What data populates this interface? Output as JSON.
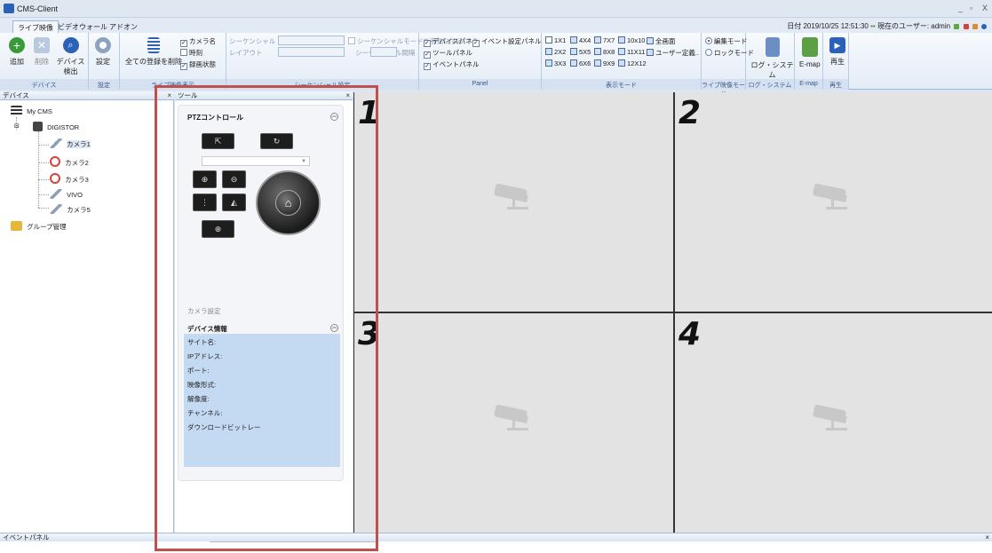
{
  "window": {
    "title": "CMS-Client",
    "controls": [
      "_",
      "▫",
      "X"
    ]
  },
  "ribbon_tabs": [
    "ライブ映像",
    "ビデオウォール",
    "アドオン"
  ],
  "date_label": "日付 2019/10/25 12:51:30 ",
  "user_label": "現在のユーザー: admin",
  "groups": {
    "device": {
      "label": "デバイス",
      "add": "追加",
      "delete": "削除",
      "detect": "デバイス検出"
    },
    "settings": {
      "label": "設定",
      "button": "設定"
    },
    "display": {
      "label": "ライブ映像表示",
      "clear_all": "全ての登録を削除",
      "camera_name": "カメラ名",
      "time": "時刻",
      "rec_status": "録画状態"
    },
    "sequence": {
      "label": "シーケンシャル設定",
      "sequential": "シーケンシャル",
      "layout": "レイアウト",
      "enable_mode": "シーケンシャルモードを有効にする",
      "interval": "シーケンシャル間隔"
    },
    "panel": {
      "label": "Panel",
      "device_panel": "デバイスパネル",
      "event_settings": "イベント設定パネル",
      "tool_panel": "ツールパネル",
      "event_panel": "イベントパネル"
    },
    "view_mode": {
      "label": "表示モード",
      "modes": [
        "1X1",
        "4X4",
        "7X7",
        "10x10",
        "全画面",
        "2X2",
        "5X5",
        "8X8",
        "11X11",
        "ユーザー定義..",
        "3X3",
        "6X6",
        "9X9",
        "12X12"
      ]
    },
    "live_mode": {
      "label": "ライブ映像モード",
      "edit": "編集モード",
      "lock": "ロックモード"
    },
    "log": {
      "label": "ログ・システム",
      "button": "ログ・システム"
    },
    "emap": {
      "label": "E-map",
      "button": "E-map"
    },
    "playback": {
      "label": "再生",
      "button": "再生"
    }
  },
  "device_panel": {
    "title": "デバイス",
    "root": "My CMS",
    "nvr": "DIGISTOR",
    "cameras": [
      {
        "name": "カメラ1",
        "status": "ok"
      },
      {
        "name": "カメラ2",
        "status": "error"
      },
      {
        "name": "カメラ3",
        "status": "error"
      },
      {
        "name": "VIVO",
        "status": "ok"
      },
      {
        "name": "カメラ5",
        "status": "ok"
      }
    ],
    "group_mgmt": "グループ管理"
  },
  "tool_panel": {
    "title": "ツール",
    "ptz_title": "PTZコントロール",
    "camera_settings": "カメラ設定",
    "device_info_title": "デバイス情報",
    "device_info_fields": [
      "サイト名:",
      "IPアドレス:",
      "ポート:",
      "映像形式:",
      "解像度:",
      "チャンネル:",
      "ダウンロードビットレー"
    ]
  },
  "video_cells": [
    "1",
    "2",
    "3",
    "4"
  ],
  "event_panel": {
    "title": "イベントパネル"
  },
  "colors": {
    "accent": "#2b62b8",
    "highlight": "#c0504d",
    "info_bg": "#c4d9f2"
  }
}
